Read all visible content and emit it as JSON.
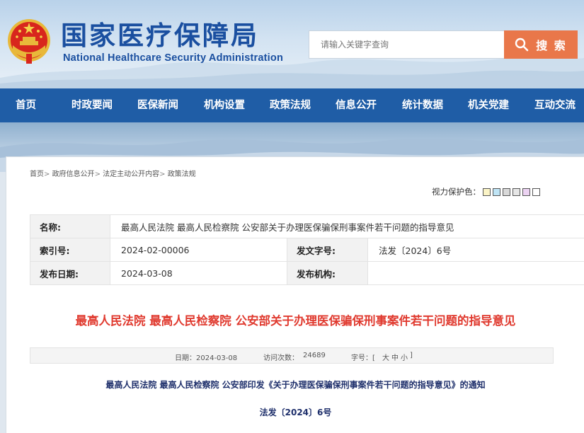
{
  "header": {
    "title": "国家医疗保障局",
    "subtitle": "National Healthcare Security Administration",
    "search_placeholder": "请输入关键字查询",
    "search_button": "搜 索"
  },
  "nav": {
    "items": [
      "首页",
      "时政要闻",
      "医保新闻",
      "机构设置",
      "政策法规",
      "信息公开",
      "统计数据",
      "机关党建",
      "互动交流"
    ]
  },
  "breadcrumb": [
    "首页",
    "政府信息公开",
    "法定主动公开内容",
    "政策法规"
  ],
  "eye_care": {
    "label": "视力保护色：",
    "colors": [
      "#fbf4c6",
      "#bfe4f5",
      "#d9d9d9",
      "#e6e6e6",
      "#ecd3f2",
      "#ffffff"
    ]
  },
  "meta": {
    "name_label": "名称:",
    "name_value": "最高人民法院 最高人民检察院 公安部关于办理医保骗保刑事案件若干问题的指导意见",
    "index_label": "索引号:",
    "index_value": "2024-02-00006",
    "docno_label": "发文字号:",
    "docno_value": "法发〔2024〕6号",
    "date_label": "发布日期:",
    "date_value": "2024-03-08",
    "org_label": "发布机构:",
    "org_value": ""
  },
  "doc": {
    "title": "最高人民法院 最高人民检察院 公安部关于办理医保骗保刑事案件若干问题的指导意见",
    "info_date": "日期：2024-03-08",
    "info_visits_label": "访问次数：",
    "info_visits": "24689",
    "info_font_label": "字号：[",
    "font_large": "大",
    "font_medium": "中",
    "font_small": "小",
    "info_font_end": "]",
    "notice_line": "最高人民法院 最高人民检察院 公安部印发《关于办理医保骗保刑事案件若干问题的指导意见》的通知",
    "doc_number": "法发〔2024〕6号"
  },
  "colors": {
    "brand_blue": "#1f5da6",
    "title_red": "#e03a2f",
    "search_orange": "#e9774a"
  }
}
